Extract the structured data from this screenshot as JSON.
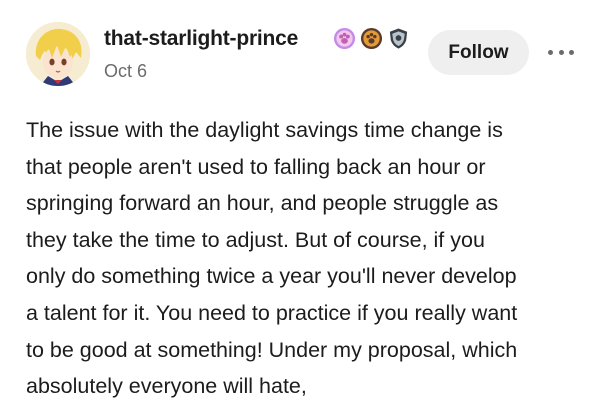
{
  "post": {
    "author": {
      "username": "that-starlight-prince",
      "date": "Oct 6",
      "badges": [
        {
          "icon": "pink-heart-paw-badge",
          "color": "#c38ae6"
        },
        {
          "icon": "paw-print-badge",
          "color": "#e39b3a"
        },
        {
          "icon": "gray-shield-badge",
          "color": "#6b7a86"
        }
      ]
    },
    "actions": {
      "follow_label": "Follow",
      "more_icon": "ellipsis-icon"
    },
    "body_lines": [
      "The issue with the daylight savings time change is",
      "that people aren't used to falling back an hour or",
      "springing forward an hour, and people struggle as",
      "they take the time to adjust. But of course, if you",
      "only do something twice a year you'll never develop",
      "a talent for it. You need to practice if you really want",
      "to be good at something! Under my proposal, which",
      "absolutely everyone will hate,"
    ]
  }
}
